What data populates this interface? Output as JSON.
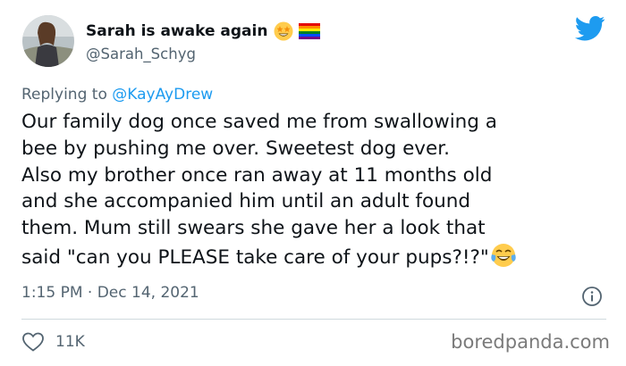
{
  "tweet": {
    "display_name": "Sarah is awake again",
    "name_icons": [
      "star-struck-emoji-icon",
      "rainbow-flag-icon"
    ],
    "handle": "@Sarah_Schyg",
    "reply_prefix": "Replying to ",
    "reply_to": "@KayAyDrew",
    "text_lines": [
      "Our family dog once saved me from swallowing a",
      "bee by pushing me over. Sweetest dog ever.",
      "Also my brother once ran away at 11 months old",
      "and she accompanied him until an adult found",
      "them. Mum still swears she gave her a look that",
      "said \"can you PLEASE take care of your pups?!?\""
    ],
    "text_end_emoji": "face-with-tears-of-joy-icon",
    "timestamp": "1:15 PM · Dec 14, 2021",
    "likes": "11K"
  },
  "brand": {
    "platform_icon": "twitter-bird-icon",
    "accent_color": "#1d9bf0"
  },
  "watermark": "boredpanda.com"
}
